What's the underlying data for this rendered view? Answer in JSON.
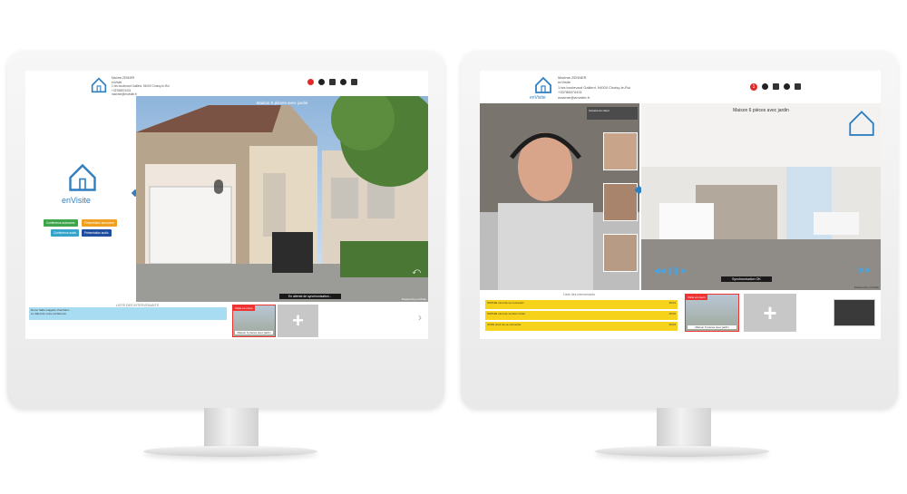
{
  "left_screen": {
    "contact_lines": [
      "Maxime ZENNER",
      "enVisite",
      "1 bis boulevard Galliéni, 94000 Choisy-le-Roi",
      "+33788574431",
      "maxime@envisite.fr"
    ],
    "brand": "enVisite",
    "panorama_title": "Maison 6 pièces avec jardin",
    "buttons": [
      "Conférence autonome",
      "Présentation autonome",
      "Conférence audio",
      "Présentation audio"
    ],
    "sync_status": "En attente de synchronisation...",
    "chat_list_title": "LISTE DES INTERVENANTS",
    "chat_messages": [
      "Demo Salle imagerie cherchant...",
      "Le début de votre conférence"
    ],
    "thumb_tag": "Visite en cours",
    "thumb_caption": "Maison 6 pièces avec jardin",
    "add_label": "+",
    "next_arrow": "›",
    "powered": "Powered by enVisite"
  },
  "right_screen": {
    "contact_lines": [
      "Maxime ZENNER",
      "enVisite",
      "1 bis boulevard Galliéni, 94000 Choisy-le-Roi",
      "+33788574431",
      "maxime@envisite.fr"
    ],
    "brand": "enVisite",
    "notif_count": "1",
    "panorama_title": "Maison 6 pièces avec jardin",
    "sync_status": "Synchronisation OK",
    "video_label": "Caméra du client",
    "chat_list_title": "Liste des intervenants",
    "chat_messages": [
      {
        "name": "SOPHIE",
        "text": "vient de se connecter",
        "time": "16:01"
      },
      {
        "name": "SOPHIE",
        "text": "vient de se faire inviter",
        "time": "16:02"
      },
      {
        "name": "JOHN",
        "text": "vient de se connecter",
        "time": "16:03"
      }
    ],
    "thumb_tag": "Visite en cours",
    "thumb_caption": "Maison 6 pièces avec jardin",
    "add_label": "+",
    "powered": "Powered by enVisite"
  },
  "colors": {
    "brand_blue": "#2f7fc1",
    "green": "#3ea54a",
    "orange": "#f0a020",
    "teal": "#36a3c8",
    "navy": "#1f4e9e",
    "yellow": "#f7d21a",
    "red": "#e33333"
  }
}
